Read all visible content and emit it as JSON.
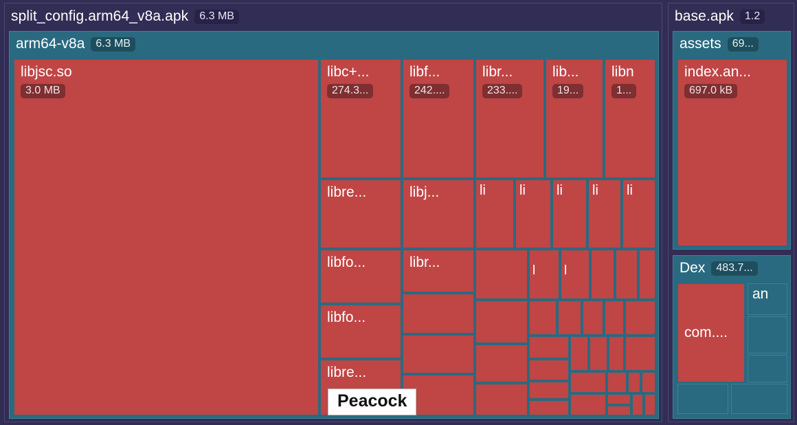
{
  "app": {
    "background_color": "#322d54",
    "group_color": "#2a6a80",
    "leaf_color": "#c04545"
  },
  "tooltip": {
    "label": "Peacock"
  },
  "panels": [
    {
      "name": "split-config-panel",
      "title": "split_config.arm64_v8a.apk",
      "size": "6.3 MB",
      "group": {
        "title": "arm64-v8a",
        "size": "6.3 MB"
      }
    },
    {
      "name": "base-apk-panel",
      "title": "base.apk",
      "size": "1.2",
      "groups": [
        {
          "title": "assets",
          "size": "69..."
        },
        {
          "title": "Dex",
          "size": "483.7..."
        }
      ]
    }
  ],
  "cells": {
    "libjsc": {
      "name": "libjsc.so",
      "size": "3.0 MB"
    },
    "libcpp": {
      "name": "libc+...",
      "size": "274.3..."
    },
    "libf": {
      "name": "libf...",
      "size": "242...."
    },
    "libr": {
      "name": "libr...",
      "size": "233...."
    },
    "lib": {
      "name": "lib...",
      "size": "19..."
    },
    "libn": {
      "name": "libn",
      "size": "1..."
    },
    "libre1": {
      "name": "libre..."
    },
    "libj1": {
      "name": "libj..."
    },
    "libfo1": {
      "name": "libfo..."
    },
    "libr2": {
      "name": "libr..."
    },
    "libfo2": {
      "name": "libfo..."
    },
    "libre2": {
      "name": "libre..."
    },
    "li_a": {
      "name": "li"
    },
    "li_b": {
      "name": "li"
    },
    "li_c": {
      "name": "li"
    },
    "li_d": {
      "name": "li"
    },
    "li_e": {
      "name": "li"
    },
    "l_a": {
      "name": "l"
    },
    "l_b": {
      "name": "l"
    },
    "index": {
      "name": "index.an...",
      "size": "697.0 kB"
    },
    "com": {
      "name": "com...."
    },
    "an": {
      "name": "an"
    }
  },
  "chart_data": {
    "type": "treemap",
    "title": "APK size treemap",
    "roots": [
      {
        "label": "split_config.arm64_v8a.apk",
        "size_label": "6.3 MB",
        "children": [
          {
            "label": "arm64-v8a",
            "size_label": "6.3 MB",
            "children": [
              {
                "label": "libjsc.so",
                "size_label": "3.0 MB"
              },
              {
                "label": "libc+...",
                "size_label": "274.3..."
              },
              {
                "label": "libf...",
                "size_label": "242...."
              },
              {
                "label": "libr...",
                "size_label": "233...."
              },
              {
                "label": "lib...",
                "size_label": "19..."
              },
              {
                "label": "libn",
                "size_label": "1..."
              },
              {
                "label": "libre..."
              },
              {
                "label": "libj..."
              },
              {
                "label": "libfo..."
              },
              {
                "label": "libr..."
              },
              {
                "label": "libfo..."
              },
              {
                "label": "libre..."
              },
              {
                "label": "li"
              },
              {
                "label": "li"
              },
              {
                "label": "li"
              },
              {
                "label": "li"
              },
              {
                "label": "li"
              },
              {
                "label": "l"
              },
              {
                "label": "l"
              }
            ]
          }
        ]
      },
      {
        "label": "base.apk",
        "size_label": "1.2",
        "children": [
          {
            "label": "assets",
            "size_label": "69...",
            "children": [
              {
                "label": "index.an...",
                "size_label": "697.0 kB"
              }
            ]
          },
          {
            "label": "Dex",
            "size_label": "483.7...",
            "children": [
              {
                "label": "com...."
              },
              {
                "label": "an"
              }
            ]
          }
        ]
      }
    ]
  }
}
